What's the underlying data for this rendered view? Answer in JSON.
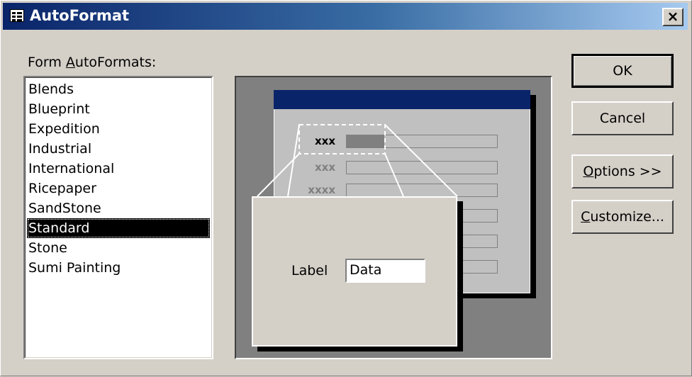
{
  "window": {
    "title": "AutoFormat",
    "close_label": "×"
  },
  "list": {
    "label": "Form AutoFormats:",
    "label_prefix": "Form ",
    "label_access": "A",
    "label_rest": "utoFormats:",
    "items": [
      {
        "label": "Blends"
      },
      {
        "label": "Blueprint"
      },
      {
        "label": "Expedition"
      },
      {
        "label": "Industrial"
      },
      {
        "label": "International"
      },
      {
        "label": "Ricepaper"
      },
      {
        "label": "SandStone"
      },
      {
        "label": "Standard"
      },
      {
        "label": "Stone"
      },
      {
        "label": "Sumi Painting"
      }
    ],
    "selected": "Standard"
  },
  "preview": {
    "labels": [
      "xxx",
      "xxx",
      "xxxx"
    ],
    "popup_label": "Label",
    "popup_value": "Data"
  },
  "buttons": {
    "ok": "OK",
    "cancel": "Cancel",
    "options_access": "O",
    "options_rest": "ptions >>",
    "customize_access": "C",
    "customize_rest": "ustomize..."
  },
  "colors": {
    "titlebar_start": "#0a246a",
    "face": "#d4d0c8",
    "selection": "#000000"
  }
}
